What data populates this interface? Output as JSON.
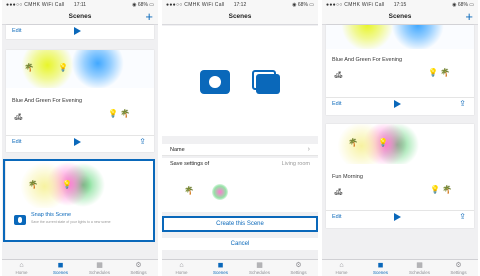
{
  "status": {
    "carrier": "●●●○○ CMHK WiFi Call",
    "times": [
      "17:11",
      "17:12",
      "17:15"
    ],
    "battery": "◉ 68% ▭"
  },
  "nav": {
    "title": "Scenes",
    "add_label": "+"
  },
  "tabs": [
    {
      "label": "Home",
      "icon": "house-icon"
    },
    {
      "label": "Scenes",
      "icon": "camera-icon"
    },
    {
      "label": "Schedules",
      "icon": "calendar-icon"
    },
    {
      "label": "Settings",
      "icon": "gear-icon"
    }
  ],
  "card_actions": {
    "edit": "Edit",
    "share": "⇪"
  },
  "panel1": {
    "scene": {
      "name": "Blue And Green For Evening"
    },
    "snap": {
      "title": "Snap this Scene",
      "desc": "Save the current state of your lights to a new scene"
    }
  },
  "panel2": {
    "name_label": "Name",
    "save_label": "Save settings of",
    "save_value": "Living room",
    "create_label": "Create this Scene",
    "cancel_label": "Cancel"
  },
  "panel3": {
    "scenes": [
      {
        "name": "Blue And Green For Evening"
      },
      {
        "name": "Fun Morning"
      }
    ]
  },
  "colors": {
    "accent": "#0a68ba",
    "highlight": "#0a68ba"
  }
}
